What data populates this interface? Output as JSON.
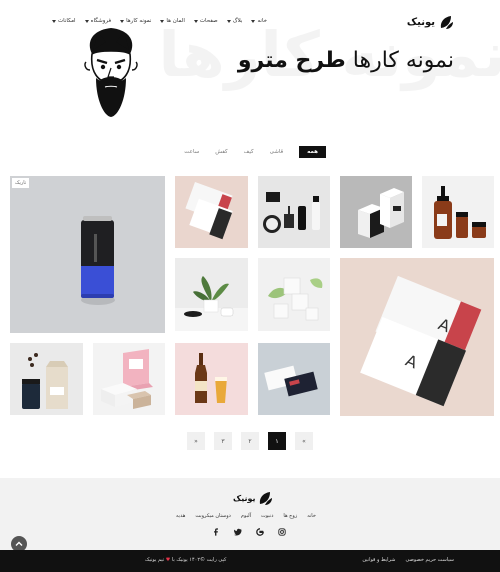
{
  "header": {
    "logo_text": "یونیک",
    "watermark": "نمونه کارها",
    "title_normal": "نمونه کارها",
    "title_bold": "طرح مترو",
    "nav": [
      {
        "label": "خانه",
        "has_caret": true
      },
      {
        "label": "بلاگ",
        "has_caret": true
      },
      {
        "label": "صفحات",
        "has_caret": true
      },
      {
        "label": "المان ها",
        "has_caret": true
      },
      {
        "label": "نمونه کارها",
        "has_caret": true
      },
      {
        "label": "فروشگاه",
        "has_caret": true
      },
      {
        "label": "امکانات",
        "has_caret": true
      }
    ]
  },
  "filters": [
    {
      "label": "همه",
      "active": true
    },
    {
      "label": "قاشی",
      "active": false
    },
    {
      "label": "کیف",
      "active": false
    },
    {
      "label": "کفش",
      "active": false
    },
    {
      "label": "ساعت",
      "active": false
    }
  ],
  "portfolio": {
    "tag": "تاریک",
    "items": [
      {
        "name": "can",
        "bg": "#cfd1d4"
      },
      {
        "name": "sachets",
        "bg": "#ead6ce"
      },
      {
        "name": "cosmetics",
        "bg": "#e6e6e6"
      },
      {
        "name": "boxes",
        "bg": "#b9b9b9"
      },
      {
        "name": "bottles",
        "bg": "#f2f2f2"
      },
      {
        "name": "plant",
        "bg": "#ececec"
      },
      {
        "name": "leaves-cubes",
        "bg": "#f1f1f1"
      },
      {
        "name": "sachets-large",
        "bg": "#ead8cf"
      },
      {
        "name": "coffee",
        "bg": "#eaeaea"
      },
      {
        "name": "pink-boxes",
        "bg": "#f3f3f3"
      },
      {
        "name": "beer",
        "bg": "#f4dcdc"
      },
      {
        "name": "cards",
        "bg": "#c9d0d6"
      }
    ]
  },
  "pagination": [
    {
      "label": "»",
      "active": false
    },
    {
      "label": "۳",
      "active": false
    },
    {
      "label": "۲",
      "active": false
    },
    {
      "label": "۱",
      "active": true
    },
    {
      "label": "«",
      "active": false
    }
  ],
  "footer": {
    "logo_text": "یونیک",
    "links": [
      "خانه",
      "زوج ها",
      "دنبوت",
      "آلبوم",
      "دوستان میکروبت",
      "هدیه"
    ],
    "socials": [
      "facebook-icon",
      "twitter-icon",
      "google-icon",
      "instagram-icon"
    ],
    "copyright_pre": "کپی رایت ©۱۴۰۲ یونیک با",
    "copyright_post": "تیم یونیک",
    "legal": [
      "سیاست حریم خصوصی",
      "شرایط و قوانین"
    ]
  },
  "colors": {
    "accent": "#111111",
    "heart": "#e2344a",
    "footer_bg": "#f2f2f2"
  }
}
